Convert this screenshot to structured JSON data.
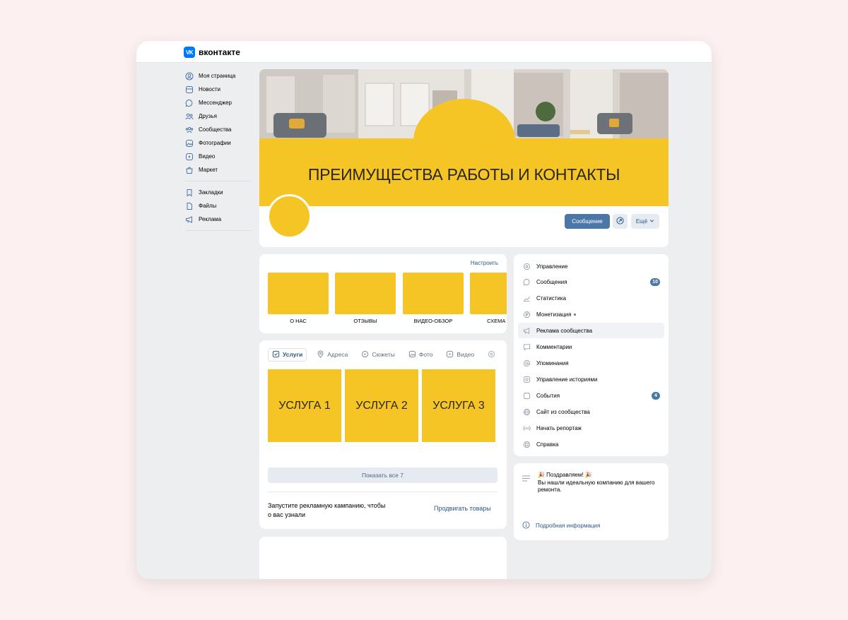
{
  "brand": {
    "logo_mark": "VK",
    "logo_text": "вконтакте"
  },
  "sidebar": {
    "items": [
      {
        "label": "Моя страница",
        "icon": "user-circle-icon"
      },
      {
        "label": "Новости",
        "icon": "news-icon"
      },
      {
        "label": "Мессенджер",
        "icon": "messenger-icon"
      },
      {
        "label": "Друзья",
        "icon": "friends-icon"
      },
      {
        "label": "Сообщества",
        "icon": "communities-icon"
      },
      {
        "label": "Фотографии",
        "icon": "photos-icon"
      },
      {
        "label": "Видео",
        "icon": "video-icon"
      },
      {
        "label": "Маркет",
        "icon": "market-icon"
      }
    ],
    "items2": [
      {
        "label": "Закладки",
        "icon": "bookmark-icon"
      },
      {
        "label": "Файлы",
        "icon": "file-icon"
      },
      {
        "label": "Реклама",
        "icon": "megaphone-icon"
      }
    ]
  },
  "cover": {
    "title": "ПРЕИМУЩЕСТВА РАБОТЫ И КОНТАКТЫ"
  },
  "actions": {
    "message": "Сообщение",
    "more": "Ещё"
  },
  "links": {
    "setup": "Настроить",
    "tiles": [
      "О НАС",
      "ОТЗЫВЫ",
      "ВИДЕО-ОБЗОР",
      "СХЕМА РА"
    ]
  },
  "services": {
    "tabs": [
      "Услуги",
      "Адреса",
      "Сюжеты",
      "Фото",
      "Видео"
    ],
    "items": [
      "УСЛУГА 1",
      "УСЛУГА 2",
      "УСЛУГА 3"
    ],
    "show_all": "Показать все 7",
    "promo_text": "Запустите рекламную кампанию, чтобы о вас узнали",
    "promo_link": "Продвигать товары"
  },
  "menu": {
    "items": [
      {
        "label": "Управление",
        "icon": "gear-icon"
      },
      {
        "label": "Сообщения",
        "icon": "message-icon",
        "badge": "10"
      },
      {
        "label": "Статистика",
        "icon": "chart-icon"
      },
      {
        "label": "Монетизация",
        "icon": "coin-icon"
      },
      {
        "label": "Реклама сообщества",
        "icon": "megaphone-icon"
      },
      {
        "label": "Комментарии",
        "icon": "comment-icon"
      },
      {
        "label": "Упоминания",
        "icon": "at-icon"
      },
      {
        "label": "Управление историями",
        "icon": "stories-icon"
      },
      {
        "label": "События",
        "icon": "calendar-icon",
        "badge": "4"
      },
      {
        "label": "Сайт из сообщества",
        "icon": "globe-icon"
      },
      {
        "label": "Начать репортаж",
        "icon": "broadcast-icon"
      },
      {
        "label": "Справка",
        "icon": "help-icon"
      }
    ]
  },
  "info": {
    "line1": "🎉 Поздравляем! 🎉",
    "line2": "Вы нашли идеальную компанию для вашего ремонта.",
    "link": "Подробная информация"
  },
  "colors": {
    "accent": "#4a76a8",
    "brand_yellow": "#f5c525",
    "vk_blue": "#0077ff"
  }
}
